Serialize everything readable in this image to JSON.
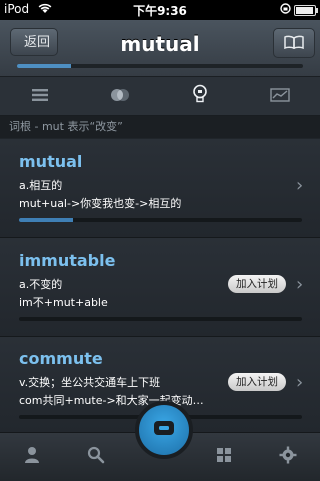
{
  "status": {
    "carrier": "iPod",
    "time": "下午9:36"
  },
  "nav": {
    "back_label": "返回",
    "title": "mutual",
    "progress": 0.19
  },
  "section": {
    "title": "词根 -  mut 表示“改变”"
  },
  "cards": [
    {
      "word": "mutual",
      "line1": "a.相互的",
      "line2": "mut+ual->你变我也变->相互的",
      "progress": 0.19,
      "plan_label": ""
    },
    {
      "word": "immutable",
      "line1": "a.不变的",
      "line2": "im不+mut+able",
      "progress": 0,
      "plan_label": "加入计划"
    },
    {
      "word": "commute",
      "line1": "v.交换；坐公共交通车上下班",
      "line2": "com共同+mute->和大家一起变动…",
      "progress": 0,
      "plan_label": "加入计划"
    }
  ],
  "icons": {
    "tabs": [
      "list-icon",
      "cards-icon",
      "lightbulb-icon",
      "chart-icon"
    ],
    "tabbar": [
      "person-icon",
      "search-icon",
      "center-home-icon",
      "grid-icon",
      "gear-icon"
    ]
  }
}
